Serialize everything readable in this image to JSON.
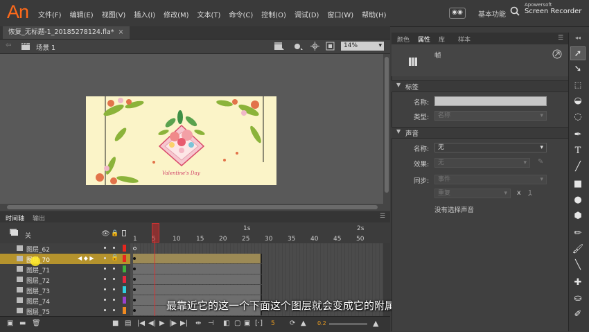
{
  "app": {
    "logo": "An"
  },
  "menu": [
    "文件(F)",
    "编辑(E)",
    "视图(V)",
    "插入(I)",
    "修改(M)",
    "文本(T)",
    "命令(C)",
    "控制(O)",
    "调试(D)",
    "窗口(W)",
    "帮助(H)"
  ],
  "header": {
    "workspace": "基本功能",
    "watermark_line1": "Apowersoft",
    "watermark_line2": "Screen Recorder"
  },
  "document_tab": {
    "title": "恢复_无标题-1_20185278124.fla*",
    "close": "×"
  },
  "scene": {
    "label": "场景 1",
    "zoom": "14%"
  },
  "stage": {
    "caption": "Valentine's Day"
  },
  "timeline": {
    "tabs": [
      "时间轴",
      "输出"
    ],
    "header_label": "关",
    "ruler": [
      "1",
      "5",
      "10",
      "15",
      "20",
      "25",
      "30",
      "35",
      "40",
      "45",
      "50"
    ],
    "ruler_seconds": [
      "1s",
      "2s"
    ],
    "layers": [
      {
        "name": "图层_62",
        "color": "#e8261e",
        "selected": false
      },
      {
        "name": "图层_70",
        "color": "#e8261e",
        "selected": true
      },
      {
        "name": "图层_71",
        "color": "#3db23d",
        "selected": false
      },
      {
        "name": "图层_72",
        "color": "#e8263e",
        "selected": false
      },
      {
        "name": "图层_73",
        "color": "#2fd0e0",
        "selected": false
      },
      {
        "name": "图层_74",
        "color": "#9a40d0",
        "selected": false
      },
      {
        "name": "图层_75",
        "color": "#f08a20",
        "selected": false
      }
    ],
    "current_frame": "5",
    "fps": "0.2"
  },
  "subtitle": "最靠近它的这一个下面这个图层就会变成它的附属图层",
  "properties": {
    "tabs": [
      "颜色",
      "属性",
      "库",
      "样本"
    ],
    "frame_label": "帧",
    "label_section": "标签",
    "name_label": "名称:",
    "type_label": "类型:",
    "type_value": "名称",
    "sound_section": "声音",
    "sound_name_label": "名称:",
    "sound_name_value": "无",
    "effect_label": "效果:",
    "effect_value": "无",
    "sync_label": "同步:",
    "sync_value": "事件",
    "repeat_value": "重复",
    "repeat_x": "x",
    "repeat_count": "1",
    "no_sound": "没有选择声音"
  },
  "colors": {
    "accent": "#ff6a1a",
    "selected_layer": "#b5932d",
    "playhead": "#cc2222"
  }
}
